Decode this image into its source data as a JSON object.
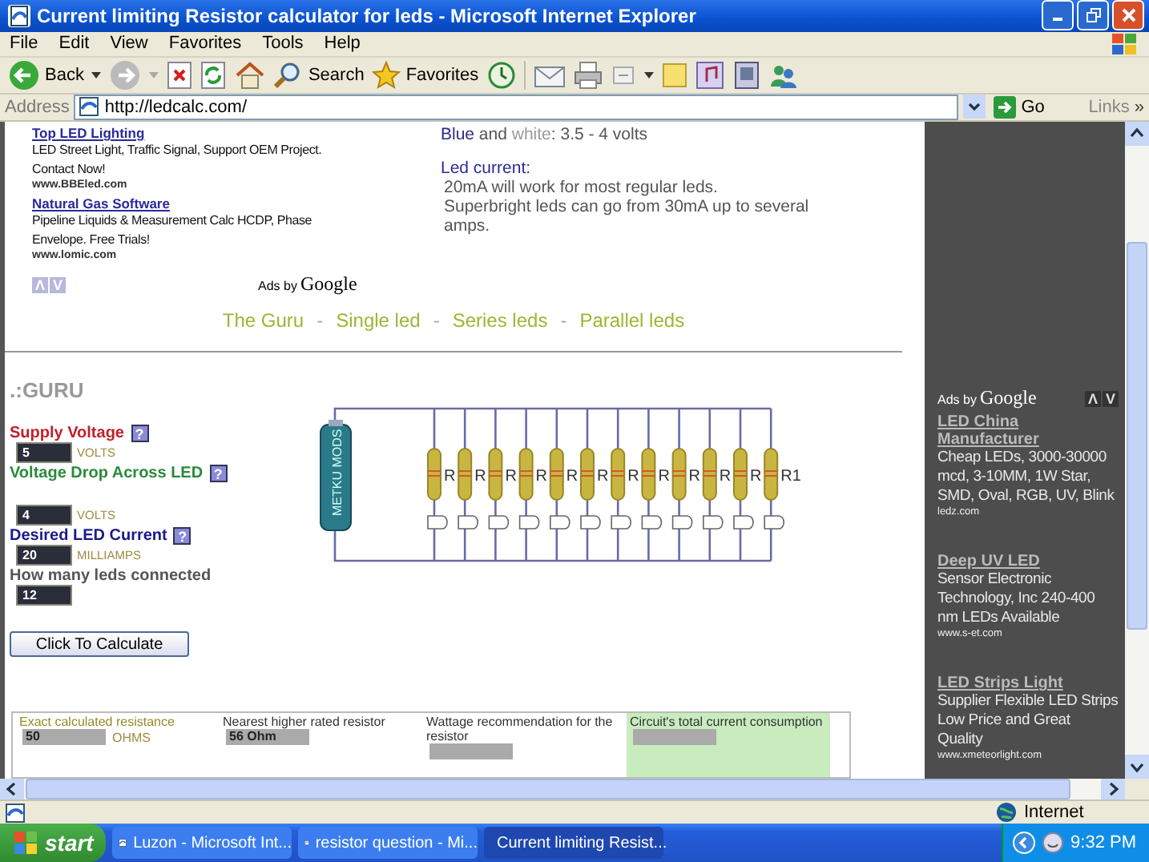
{
  "window": {
    "title": "Current limiting Resistor calculator for leds - Microsoft Internet Explorer"
  },
  "menu": [
    "File",
    "Edit",
    "View",
    "Favorites",
    "Tools",
    "Help"
  ],
  "toolbar": {
    "back": "Back",
    "search": "Search",
    "favorites": "Favorites"
  },
  "address": {
    "label": "Address",
    "value": "http://ledcalc.com/",
    "go": "Go",
    "links": "Links",
    "more": "»"
  },
  "ads_left": {
    "items": [
      {
        "title": "Top LED Lighting",
        "text": "LED Street Light, Traffic Signal, Support OEM Project. Contact Now!",
        "url": "www.BBEled.com"
      },
      {
        "title": "Natural Gas Software",
        "text": "Pipeline Liquids & Measurement Calc HCDP, Phase Envelope. Free Trials!",
        "url": "www.lomic.com"
      }
    ],
    "nav_up": "Λ",
    "nav_down": "V",
    "ads_by": "Ads by",
    "brand": "Google"
  },
  "info": {
    "color_line": [
      {
        "text": "Blue",
        "color": "#2a2a8a"
      },
      {
        "text": " and ",
        "color": "#555555"
      },
      {
        "text": "white",
        "color": "#9a9a9a"
      },
      {
        "text": ": 3.5 - 4 volts",
        "color": "#555555"
      }
    ],
    "heading": "Led current:",
    "lines": [
      "20mA will work for most regular leds.",
      "Superbright leds can go from 30mA up to several amps."
    ]
  },
  "nav": {
    "links": [
      "The Guru",
      "Single led",
      "Series leds",
      "Parallel leds"
    ],
    "separator": "-"
  },
  "guru": {
    "title": ".:GURU",
    "fields": [
      {
        "label": "Supply Voltage",
        "color": "#c0202a",
        "help": true,
        "value": "5",
        "unit": "VOLTS"
      },
      {
        "label": "Voltage Drop Across LED",
        "color": "#2a8a3a",
        "help": true,
        "value": "4",
        "unit": "VOLTS"
      },
      {
        "label": "Desired LED Current",
        "color": "#1a1a8a",
        "help": true,
        "value": "20",
        "unit": "MILLIAMPS"
      },
      {
        "label": "How many leds connected",
        "color": "#555555",
        "help": false,
        "value": "12"
      }
    ],
    "help_mark": "?",
    "button": "Click To Calculate"
  },
  "circuit": {
    "battery_label": "METKU MODS",
    "resistor_labels": [
      "R",
      "R",
      "R",
      "R",
      "R",
      "R",
      "R",
      "R",
      "R",
      "R",
      "R",
      "R1"
    ]
  },
  "results": [
    {
      "label": "Exact calculated resistance",
      "value": "50",
      "unit": "OHMS",
      "highlighted": false
    },
    {
      "label": "Nearest higher rated resistor",
      "value": "56 Ohm",
      "highlighted": false
    },
    {
      "label": "Wattage recommendation for the resistor",
      "highlighted": false
    },
    {
      "label": "Circuit's total current consumption",
      "highlighted": true
    }
  ],
  "ads_right": {
    "ads_by": "Ads by",
    "brand": "Google",
    "nav_up": "Λ",
    "nav_down": "V",
    "items": [
      {
        "title": "LED China Manufacturer",
        "text": "Cheap LEDs, 3000-30000 mcd, 3-10MM, 1W Star, SMD, Oval, RGB, UV, Blink",
        "url": "ledz.com"
      },
      {
        "title": "Deep UV LED",
        "text": "Sensor Electronic Technology, Inc 240-400 nm LEDs Available",
        "url": "www.s-et.com"
      },
      {
        "title": "LED Strips Light",
        "text": "Supplier Flexible LED Strips Low Price and Great Quality",
        "url": "www.xmeteorlight.com"
      }
    ]
  },
  "status_bar": {
    "zone": "Internet"
  },
  "taskbar": {
    "start": "start",
    "tasks": [
      {
        "label": "Luzon - Microsoft Int...",
        "selected": false
      },
      {
        "label": "resistor question - Mi...",
        "selected": false
      },
      {
        "label": "Current limiting Resist...",
        "selected": true
      }
    ],
    "clock": "9:32 PM"
  }
}
